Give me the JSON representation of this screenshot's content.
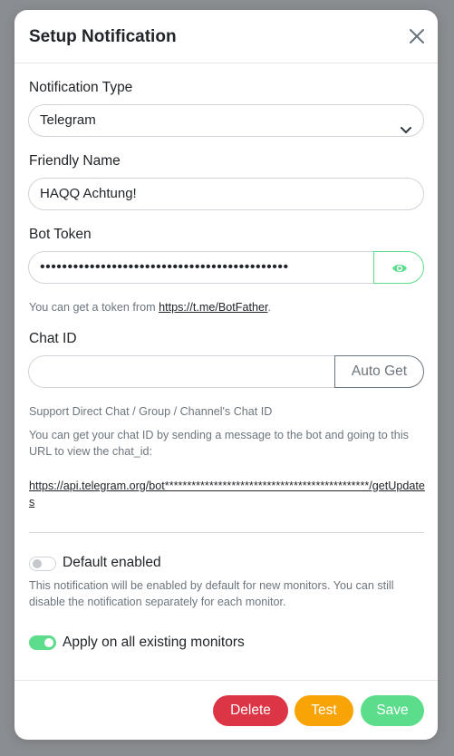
{
  "modal": {
    "title": "Setup Notification",
    "close_icon": "close-icon"
  },
  "notification_type": {
    "label": "Notification Type",
    "selected": "Telegram",
    "arrow_icon": "chevron-down-icon"
  },
  "friendly_name": {
    "label": "Friendly Name",
    "value": "HAQQ Achtung!"
  },
  "bot_token": {
    "label": "Bot Token",
    "value": "•••••••••••••••••••••••••••••••••••••••••••••",
    "toggle_icon": "eye-icon",
    "help_prefix": "You can get a token from ",
    "help_link": "https://t.me/BotFather",
    "help_suffix": "."
  },
  "chat_id": {
    "label": "Chat ID",
    "value": "",
    "auto_get_label": "Auto Get",
    "support_text": "Support Direct Chat / Group / Channel's Chat ID",
    "help_text": "You can get your chat ID by sending a message to the bot and going to this URL to view the chat_id:",
    "url": "https://api.telegram.org/bot**********************************************/getUpdates"
  },
  "default_enabled": {
    "label": "Default enabled",
    "state": false,
    "help": "This notification will be enabled by default for new monitors. You can still disable the notification separately for each monitor."
  },
  "apply_existing": {
    "label": "Apply on all existing monitors",
    "state": true
  },
  "footer": {
    "delete_label": "Delete",
    "test_label": "Test",
    "save_label": "Save"
  },
  "colors": {
    "primary_green": "#5cdd8b",
    "danger_red": "#dc3545",
    "warning_orange": "#f8a306",
    "muted_text": "#6c757d"
  }
}
